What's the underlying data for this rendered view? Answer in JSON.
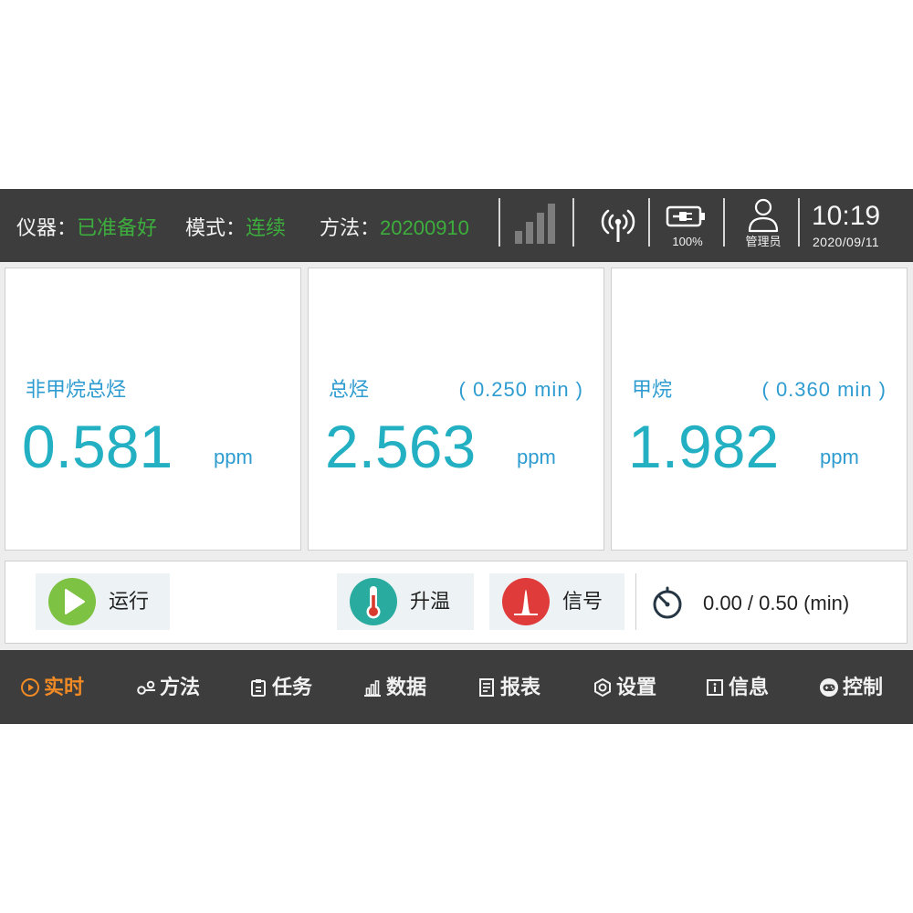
{
  "status_bar": {
    "instrument": {
      "label": "仪器：",
      "value": "已准备好"
    },
    "mode": {
      "label": "模式：",
      "value": "连续"
    },
    "method": {
      "label": "方法：",
      "value": "20200910"
    },
    "battery_percent": "100%",
    "user_role": "管理员",
    "time": "10:19",
    "date": "2020/09/11",
    "icons": {
      "signal": "signal-bars-icon",
      "antenna": "antenna-icon",
      "battery": "battery-plug-icon",
      "user": "user-icon"
    }
  },
  "readings": [
    {
      "name": "非甲烷总烃",
      "value": "0.581",
      "unit": "ppm"
    },
    {
      "name": "总烃",
      "retention": "( 0.250 min )",
      "value": "2.563",
      "unit": "ppm"
    },
    {
      "name": "甲烷",
      "retention": "( 0.360 min )",
      "value": "1.982",
      "unit": "ppm"
    }
  ],
  "controls": {
    "run": {
      "label": "运行",
      "icon": "play-icon"
    },
    "heat": {
      "label": "升温",
      "icon": "thermometer-icon"
    },
    "signal": {
      "label": "信号",
      "icon": "signal-peak-icon"
    },
    "timer": {
      "text": "0.00 / 0.50 (min)",
      "icon": "stopwatch-icon"
    }
  },
  "nav": {
    "items": [
      {
        "label": "实时",
        "icon": "play-circle-icon",
        "active": true
      },
      {
        "label": "方法",
        "icon": "method-flow-icon",
        "active": false
      },
      {
        "label": "任务",
        "icon": "clipboard-icon",
        "active": false
      },
      {
        "label": "数据",
        "icon": "bar-chart-icon",
        "active": false
      },
      {
        "label": "报表",
        "icon": "report-document-icon",
        "active": false
      },
      {
        "label": "设置",
        "icon": "hexagon-gear-icon",
        "active": false
      },
      {
        "label": "信息",
        "icon": "info-icon",
        "active": false
      },
      {
        "label": "控制",
        "icon": "gamepad-icon",
        "active": false
      }
    ]
  },
  "colors": {
    "bar_background": "#3d3d3d",
    "status_value_green": "#3dae3d",
    "reading_label": "#2e9cd0",
    "reading_value": "#22b0c2",
    "nav_active": "#f08a24",
    "run_green": "#7dc243",
    "heat_teal": "#2aab9f",
    "signal_red": "#e03b3b"
  }
}
